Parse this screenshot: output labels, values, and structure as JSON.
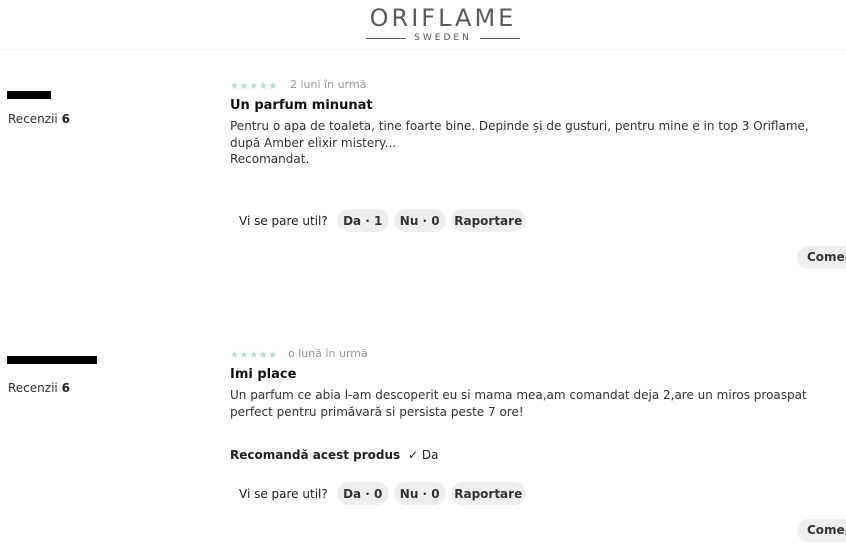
{
  "brand": {
    "name": "ORIFLAME",
    "tagline": "SWEDEN"
  },
  "reviews": [
    {
      "reviews_label": "Recenzii",
      "reviews_count": "6",
      "rating_stars": 5,
      "date": "2 luni în urmă",
      "title": "Un parfum minunat",
      "body": "Pentru o apa de toaleta, tine foarte bine. Depinde și de gusturi, pentru mine e in top 3 Oriflame, după Amber elixir mistery...",
      "body_extra": "Recomandat.",
      "useful_question": "Vi se pare util?",
      "yes_label": "Da · 1",
      "no_label": "Nu · 0",
      "report_label": "Raportare",
      "comment_label": "Comen"
    },
    {
      "reviews_label": "Recenzii",
      "reviews_count": "6",
      "rating_stars": 5,
      "date": "o lună în urmă",
      "title": "Imi place",
      "body": "Un parfum ce abia l-am descoperit eu si mama mea,am comandat deja 2,are un miros proaspat perfect pentru primăvară si persista peste 7 ore!",
      "recommend_label": "Recomandă acest produs",
      "recommend_check": "✓",
      "recommend_value": "Da",
      "useful_question": "Vi se pare util?",
      "yes_label": "Da · 0",
      "no_label": "Nu · 0",
      "report_label": "Raportare",
      "comment_label": "Comen"
    }
  ],
  "colors": {
    "star": "#b7ddd6",
    "pill_bg": "#eeeeee",
    "logo": "#5b5b5b"
  }
}
